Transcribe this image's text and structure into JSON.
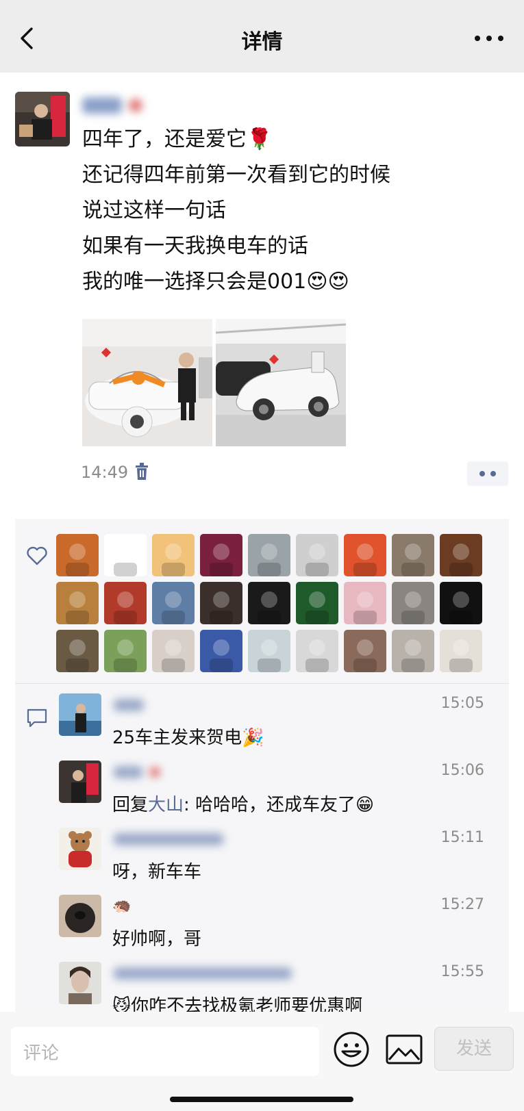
{
  "nav": {
    "title": "详情"
  },
  "post": {
    "lines": [
      "四年了，还是爱它🌹",
      "还记得四年前第一次看到它的时候",
      "说过这样一句话",
      "如果有一天我换电车的话",
      "我的唯一选择只会是001😍😍"
    ],
    "time": "14:49"
  },
  "likers_count": 27,
  "comments": [
    {
      "time": "15:05",
      "text": "25车主发来贺电🎉"
    },
    {
      "time": "15:06",
      "prefix": "回复",
      "link": "大山",
      "text": ": 哈哈哈，还成车友了😁"
    },
    {
      "time": "15:11",
      "text": "呀，新车车"
    },
    {
      "time": "15:27",
      "name": "🦔",
      "text": "好帅啊，哥"
    },
    {
      "time": "15:55",
      "text": "😼你咋不去找极氪老师要优惠啊"
    }
  ],
  "input": {
    "placeholder": "评论"
  },
  "send_label": "发送",
  "colors": {
    "link": "#576b95",
    "nav_bg": "#ededed",
    "panel_bg": "#f6f6f8"
  }
}
